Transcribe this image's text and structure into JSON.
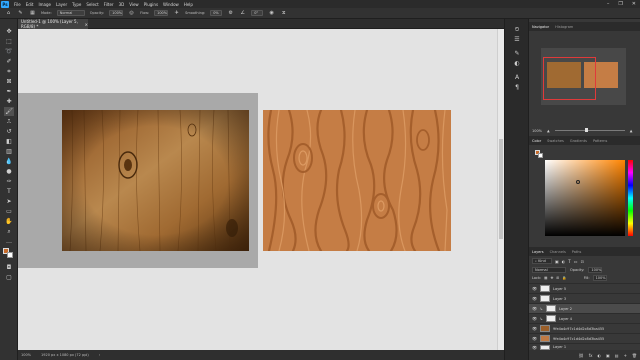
{
  "app": {
    "logo": "Ps",
    "menu": [
      "File",
      "Edit",
      "Image",
      "Layer",
      "Type",
      "Select",
      "Filter",
      "3D",
      "View",
      "Plugins",
      "Window",
      "Help"
    ],
    "window_controls": [
      "–",
      "❐",
      "✕"
    ]
  },
  "options_bar": {
    "mode_label": "Mode:",
    "mode_value": "Normal",
    "opacity_label": "Opacity:",
    "opacity_value": "100%",
    "flow_label": "Flow:",
    "flow_value": "100%",
    "smoothing_label": "Smoothing:",
    "smoothing_value": "0%",
    "angle_value": "0°"
  },
  "document": {
    "tab_title": "Untitled-1 @ 100% (Layer 5, RGB/8) *",
    "close_glyph": "×"
  },
  "status_bar": {
    "zoom": "100%",
    "doc_size": "1920 px x 1080 px (72 ppi)"
  },
  "navigator": {
    "tabs": [
      "Navigator",
      "Histogram"
    ],
    "zoom": "100%"
  },
  "color_panel": {
    "tabs": [
      "Color",
      "Swatches",
      "Gradients",
      "Patterns"
    ],
    "foreground": "#c86c2c",
    "background": "#ffffff"
  },
  "layers_panel": {
    "tabs": [
      "Layers",
      "Channels",
      "Paths"
    ],
    "filter_value": "Kind",
    "blend_mode": "Normal",
    "opacity_label": "Opacity:",
    "opacity_value": "100%",
    "lock_label": "Lock:",
    "fill_label": "Fill:",
    "fill_value": "100%",
    "layers": [
      {
        "name": "Layer 5",
        "selected": false,
        "thumb": "white"
      },
      {
        "name": "Layer 3",
        "selected": false,
        "thumb": "white"
      },
      {
        "name": "Layer 2",
        "selected": true,
        "thumb": "white"
      },
      {
        "name": "Layer 4",
        "selected": false,
        "thumb": "white"
      },
      {
        "name": "9fe4a4c97c1d4d2c8d3ba455",
        "selected": false,
        "thumb": "wood1"
      },
      {
        "name": "9fe4a4c97c1d4d2c8d3ba455",
        "selected": false,
        "thumb": "wood2"
      },
      {
        "name": "Layer 1",
        "selected": false,
        "thumb": "white"
      }
    ],
    "footer_icons": [
      "fx",
      "◐",
      "▣",
      "▤",
      "+",
      "🗑"
    ]
  },
  "colors": {
    "accent": "#31a8ff",
    "navigator_frame": "#e03a3a",
    "hue": "#ff8400"
  }
}
